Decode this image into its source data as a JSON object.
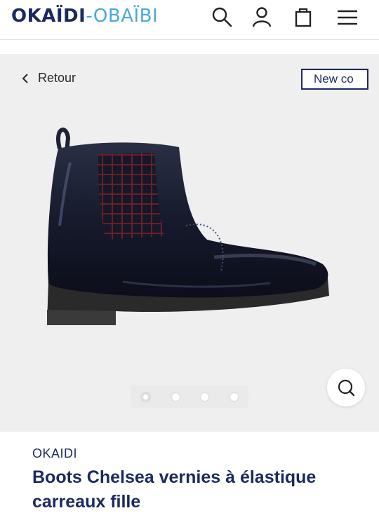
{
  "header": {
    "logo_primary": "OKAÏDI",
    "logo_separator": "-",
    "logo_secondary": "OBAÏBI",
    "icons": [
      "search-icon",
      "user-icon",
      "bag-icon",
      "menu-icon"
    ]
  },
  "gallery": {
    "back_label": "Retour",
    "badge_label": "New co",
    "slide_count": 4,
    "active_slide": 1,
    "zoom_icon": "zoom-icon"
  },
  "product": {
    "brand": "OKAIDI",
    "title": "Boots Chelsea vernies à élastique carreaux fille"
  },
  "colors": {
    "brand_navy": "#1b2a5e",
    "logo_light_blue": "#4aa8d8",
    "gallery_bg": "#efefef"
  }
}
